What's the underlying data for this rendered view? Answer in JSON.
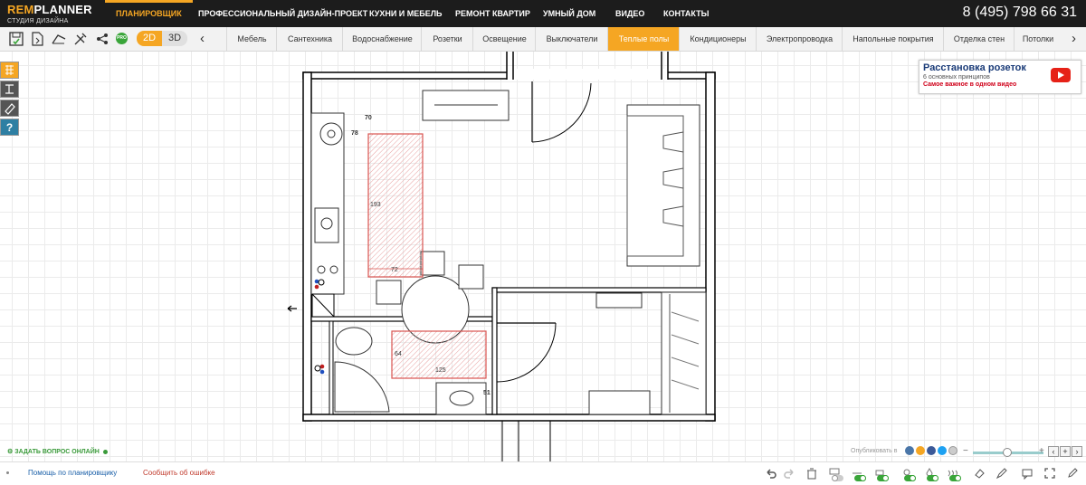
{
  "logo": {
    "brand_part1": "REM",
    "brand_part2": "PLANNER",
    "subtitle": "СТУДИЯ ДИЗАЙНА"
  },
  "nav": [
    "ПЛАНИРОВЩИК",
    "ПРОФЕССИОНАЛЬНЫЙ ДИЗАЙН-ПРОЕКТ",
    "КУХНИ И МЕБЕЛЬ",
    "РЕМОНТ КВАРТИР",
    "УМНЫЙ ДОМ",
    "ВИДЕО",
    "КОНТАКТЫ"
  ],
  "phone": "8 (495) 798 66 31",
  "toolbar": {
    "pro_badge": "PRO",
    "mode_2d": "2D",
    "mode_3d": "3D",
    "categories": [
      "Мебель",
      "Сантехника",
      "Водоснабжение",
      "Розетки",
      "Освещение",
      "Выключатели",
      "Теплые полы",
      "Кондиционеры",
      "Электропроводка",
      "Напольные покрытия",
      "Отделка стен",
      "Потолки"
    ],
    "active_category": "Теплые полы",
    "prev_arrow": "‹",
    "next_arrow": "›"
  },
  "side_tools": {
    "help_label": "?"
  },
  "ad": {
    "title": "Расстановка розеток",
    "line2": "6 основных принципов",
    "line3": "Самое важное в одном видео"
  },
  "plan": {
    "dims": {
      "d70": "70",
      "d78": "78",
      "d193": "193",
      "d72": "72",
      "d64": "64",
      "d125": "125",
      "d51": "51"
    }
  },
  "canvas_bottom": {
    "ask_question": "ЗАДАТЬ ВОПРОС ОНЛАЙН",
    "publish": "Опубликовать в",
    "zoom_minus": "−",
    "zoom_plus": "+"
  },
  "status": {
    "help_link": "Помощь по планировщику",
    "report_error": "Сообщить об ошибке"
  },
  "colors": {
    "accent": "#f5a623",
    "nav_bg": "#1c1c1c",
    "floor_heating": "#d9534f",
    "wall": "#000000"
  }
}
